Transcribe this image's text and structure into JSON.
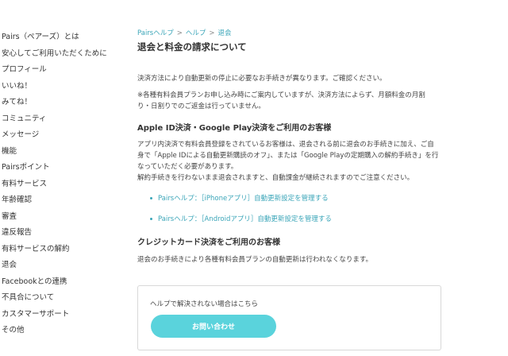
{
  "sidebar": {
    "items": [
      {
        "label": "Pairs（ペアーズ）とは"
      },
      {
        "label": "安心してご利用いただくために"
      },
      {
        "label": "プロフィール"
      },
      {
        "label": "いいね！"
      },
      {
        "label": "みてね！"
      },
      {
        "label": "コミュニティ"
      },
      {
        "label": "メッセージ"
      },
      {
        "label": "機能"
      },
      {
        "label": "Pairsポイント"
      },
      {
        "label": "有料サービス"
      },
      {
        "label": "年齢確認"
      },
      {
        "label": "審査"
      },
      {
        "label": "違反報告"
      },
      {
        "label": "有料サービスの解約"
      },
      {
        "label": "退会"
      },
      {
        "label": "Facebookとの連携"
      },
      {
        "label": "不具合について"
      },
      {
        "label": "カスタマーサポート"
      },
      {
        "label": "その他"
      }
    ]
  },
  "breadcrumb": {
    "items": [
      "Pairsヘルプ",
      "ヘルプ",
      "退会"
    ],
    "separator": ">"
  },
  "main": {
    "title": "退会と料金の請求について",
    "intro1": "決済方法により自動更新の停止に必要なお手続きが異なります。ご確認ください。",
    "intro2_line1": "※各種有料会員プランお申し込み時にご案内していますが、決済方法によらず、月額料金の月割",
    "intro2_line2": "り・日割りでのご返金は行っていません。",
    "section1": {
      "heading": "Apple ID決済・Google Play決済をご利用のお客様",
      "body_line1": "アプリ内決済で有料会員登録をされているお客様は、退会される前に退会のお手続きに加え、ご自",
      "body_line2": "身で「Apple IDによる自動更新購読のオフ」、または「Google Playの定期購入の解約手続き」を行",
      "body_line3": "なっていただく必要があります。",
      "body_line4": "解約手続きを行わないまま退会されますと、自動課金が継続されますのでご注意ください。",
      "links": [
        {
          "label": "Pairsヘルプ：［iPhoneアプリ］自動更新設定を管理する"
        },
        {
          "label": "Pairsヘルプ：［Androidアプリ］自動更新設定を管理する"
        }
      ]
    },
    "section2": {
      "heading": "クレジットカード決済をご利用のお客様",
      "body": "退会のお手続きにより各種有料会員プランの自動更新は行われなくなります。"
    }
  },
  "help_box": {
    "text": "ヘルプで解決されない場合はこちら",
    "button_label": "お問い合わせ"
  },
  "colors": {
    "accent": "#3aa5b8",
    "button": "#5ad3dc"
  }
}
